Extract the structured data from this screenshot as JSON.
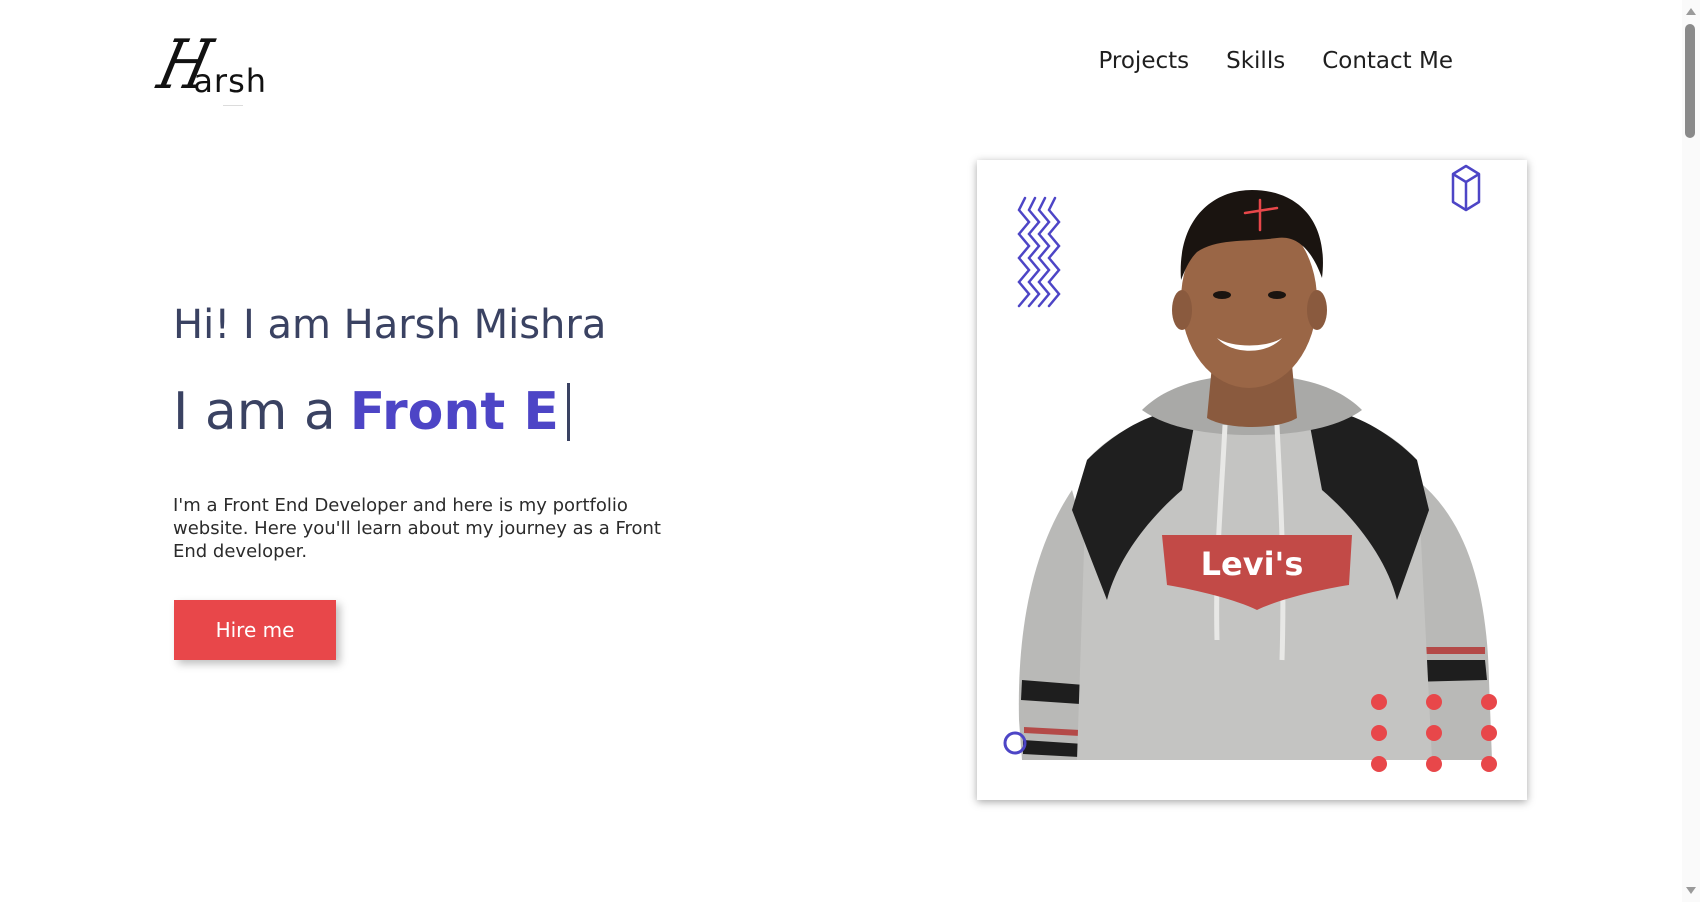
{
  "header": {
    "logo_initial": "H",
    "logo_rest": "arsh",
    "nav": [
      {
        "label": "Projects"
      },
      {
        "label": "Skills"
      },
      {
        "label": "Contact Me"
      }
    ]
  },
  "hero": {
    "greeting": "Hi! I am Harsh Mishra",
    "role_prefix": "I am a",
    "role_typed": "Front E",
    "description": "I'm a Front End Developer and here is my portfolio website. Here you'll learn about my journey as a Front End developer.",
    "cta_label": "Hire me"
  },
  "photo": {
    "shirt_logo_text": "Levi's"
  },
  "colors": {
    "accent_purple": "#4d45c6",
    "accent_red": "#e8474a",
    "heading_text": "#3a4262"
  },
  "icons": [
    "zigzag-icon",
    "cross-icon",
    "cube-icon",
    "circle-icon",
    "dots-grid-icon"
  ]
}
